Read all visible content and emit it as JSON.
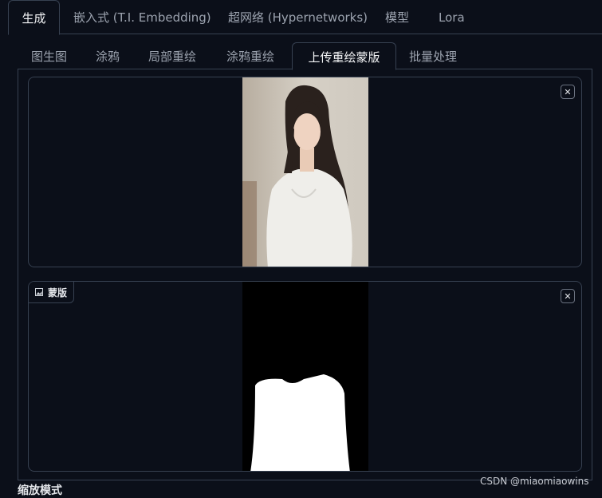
{
  "top_tabs": [
    {
      "label": "生成",
      "active": true
    },
    {
      "label": "嵌入式 (T.I. Embedding)",
      "active": false
    },
    {
      "label": "超网络 (Hypernetworks)",
      "active": false
    },
    {
      "label": "模型",
      "active": false
    },
    {
      "label": "Lora",
      "active": false
    }
  ],
  "sub_tabs": [
    {
      "label": "图生图",
      "active": false
    },
    {
      "label": "涂鸦",
      "active": false
    },
    {
      "label": "局部重绘",
      "active": false
    },
    {
      "label": "涂鸦重绘",
      "active": false
    },
    {
      "label": "上传重绘蒙版",
      "active": true
    },
    {
      "label": "批量处理",
      "active": false
    }
  ],
  "image_box": {
    "close_icon": "close-icon"
  },
  "mask_box": {
    "label": "蒙版",
    "label_icon": "image-icon",
    "close_icon": "close-icon"
  },
  "bottom_label": "缩放模式",
  "watermark": "CSDN @miaomiaowins",
  "colors": {
    "background": "#0b0f19",
    "border": "#374151",
    "text_active": "#f3f4f6",
    "text_inactive": "#9ca3af"
  }
}
